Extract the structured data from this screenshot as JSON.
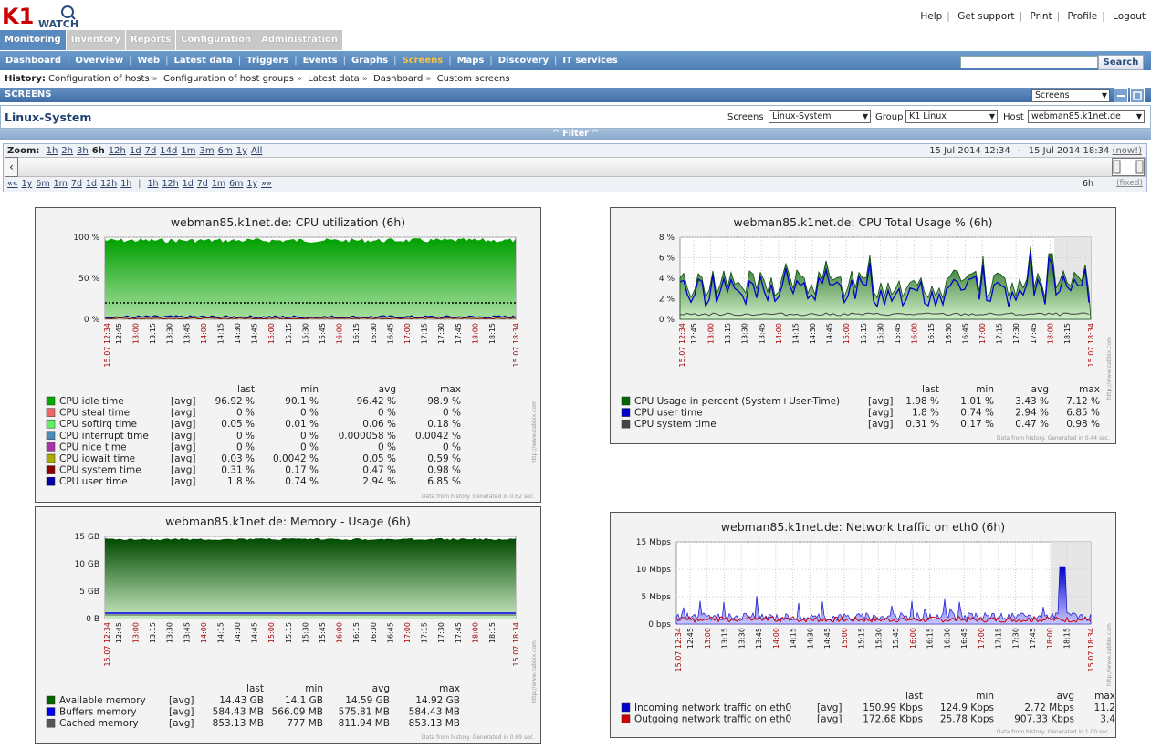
{
  "logo": {
    "k1": "K1",
    "watch": "WATCH"
  },
  "toplinks": [
    "Help",
    "Get support",
    "Print",
    "Profile",
    "Logout"
  ],
  "mainnav": [
    {
      "label": "Monitoring",
      "active": true
    },
    {
      "label": "Inventory",
      "active": false
    },
    {
      "label": "Reports",
      "active": false
    },
    {
      "label": "Configuration",
      "active": false
    },
    {
      "label": "Administration",
      "active": false
    }
  ],
  "subnav": [
    {
      "label": "Dashboard",
      "active": false
    },
    {
      "label": "Overview",
      "active": false
    },
    {
      "label": "Web",
      "active": false
    },
    {
      "label": "Latest data",
      "active": false
    },
    {
      "label": "Triggers",
      "active": false
    },
    {
      "label": "Events",
      "active": false
    },
    {
      "label": "Graphs",
      "active": false
    },
    {
      "label": "Screens",
      "active": true
    },
    {
      "label": "Maps",
      "active": false
    },
    {
      "label": "Discovery",
      "active": false
    },
    {
      "label": "IT services",
      "active": false
    }
  ],
  "search": {
    "value": "",
    "button": "Search"
  },
  "history": {
    "label": "History:",
    "items": [
      "Configuration of hosts",
      "Configuration of host groups",
      "Latest data",
      "Dashboard",
      "Custom screens"
    ]
  },
  "screensbar": {
    "title": "SCREENS",
    "select": "Screens"
  },
  "screen": {
    "title": "Linux-System",
    "screens_label": "Screens",
    "screens_value": "Linux-System",
    "group_label": "Group",
    "group_value": "K1 Linux",
    "host_label": "Host",
    "host_value": "webman85.k1net.de"
  },
  "filter": {
    "label": "Filter"
  },
  "zoom": {
    "label": "Zoom:",
    "options": [
      "1h",
      "2h",
      "3h",
      "6h",
      "12h",
      "1d",
      "7d",
      "14d",
      "1m",
      "3m",
      "6m",
      "1y",
      "All"
    ],
    "active": "6h",
    "from": "15 Jul 2014 12:34",
    "dash": "-",
    "to": "15 Jul 2014 18:34",
    "now": "(now!)",
    "nav_back": [
      "««",
      "1y",
      "6m",
      "1m",
      "7d",
      "1d",
      "12h",
      "1h"
    ],
    "nav_fwd": [
      "1h",
      "12h",
      "1d",
      "7d",
      "1m",
      "6m",
      "1y",
      "»»"
    ],
    "period": "6h",
    "fixed": "(fixed)"
  },
  "graphs": {
    "time_ticks": [
      "12:45",
      "13:00",
      "13:15",
      "13:30",
      "13:45",
      "14:00",
      "14:15",
      "14:30",
      "14:45",
      "15:00",
      "15:15",
      "15:30",
      "15:45",
      "16:00",
      "16:15",
      "16:30",
      "16:45",
      "17:00",
      "17:15",
      "17:30",
      "17:45",
      "18:00",
      "18:15"
    ],
    "time_start": "15.07 12:34",
    "time_end": "15.07 18:34",
    "col_headers": [
      "last",
      "min",
      "avg",
      "max"
    ],
    "watermark": "http://www.zabbix.com",
    "cpu": {
      "title": "webman85.k1net.de: CPU utilization (6h)",
      "yticks": [
        "100 %",
        "50 %",
        "0 %"
      ],
      "legend": [
        {
          "color": "#00aa00",
          "name": "CPU idle time",
          "fn": "[avg]",
          "last": "96.92 %",
          "min": "90.1 %",
          "avg": "96.42 %",
          "max": "98.9 %"
        },
        {
          "color": "#ee6666",
          "name": "CPU steal time",
          "fn": "[avg]",
          "last": "0 %",
          "min": "0 %",
          "avg": "0 %",
          "max": "0 %"
        },
        {
          "color": "#66ee66",
          "name": "CPU softirq time",
          "fn": "[avg]",
          "last": "0.05 %",
          "min": "0.01 %",
          "avg": "0.06 %",
          "max": "0.18 %"
        },
        {
          "color": "#4a8ab8",
          "name": "CPU interrupt time",
          "fn": "[avg]",
          "last": "0 %",
          "min": "0 %",
          "avg": "0.000058 %",
          "max": "0.0042 %"
        },
        {
          "color": "#aa33aa",
          "name": "CPU nice time",
          "fn": "[avg]",
          "last": "0 %",
          "min": "0 %",
          "avg": "0 %",
          "max": "0 %"
        },
        {
          "color": "#aaaa00",
          "name": "CPU iowait time",
          "fn": "[avg]",
          "last": "0.03 %",
          "min": "0.0042 %",
          "avg": "0.05 %",
          "max": "0.59 %"
        },
        {
          "color": "#880000",
          "name": "CPU system time",
          "fn": "[avg]",
          "last": "0.31 %",
          "min": "0.17 %",
          "avg": "0.47 %",
          "max": "0.98 %"
        },
        {
          "color": "#0000aa",
          "name": "CPU user time",
          "fn": "[avg]",
          "last": "1.8 %",
          "min": "0.74 %",
          "avg": "2.94 %",
          "max": "6.85 %"
        }
      ],
      "footer": "Data from history. Generated in 0.62 sec."
    },
    "cputotal": {
      "title": "webman85.k1net.de: CPU Total Usage % (6h)",
      "yticks": [
        "8 %",
        "6 %",
        "4 %",
        "2 %",
        "0 %"
      ],
      "legend": [
        {
          "color": "#006600",
          "name": "CPU Usage in percent (System+User-Time)",
          "fn": "[avg]",
          "last": "1.98 %",
          "min": "1.01 %",
          "avg": "3.43 %",
          "max": "7.12 %"
        },
        {
          "color": "#0000cc",
          "name": "CPU user time",
          "fn": "[avg]",
          "last": "1.8 %",
          "min": "0.74 %",
          "avg": "2.94 %",
          "max": "6.85 %"
        },
        {
          "color": "#444444",
          "name": "CPU system time",
          "fn": "[avg]",
          "last": "0.31 %",
          "min": "0.17 %",
          "avg": "0.47 %",
          "max": "0.98 %"
        }
      ],
      "footer": "Data from history. Generated in 0.44 sec."
    },
    "memory": {
      "title": "webman85.k1net.de: Memory - Usage (6h)",
      "yticks": [
        "15 GB",
        "10 GB",
        "5 GB",
        "0 B"
      ],
      "legend": [
        {
          "color": "#006600",
          "name": "Available memory",
          "fn": "[avg]",
          "last": "14.43 GB",
          "min": "14.1 GB",
          "avg": "14.59 GB",
          "max": "14.92 GB"
        },
        {
          "color": "#0000ee",
          "name": "Buffers memory",
          "fn": "[avg]",
          "last": "584.43 MB",
          "min": "566.09 MB",
          "avg": "575.81 MB",
          "max": "584.43 MB"
        },
        {
          "color": "#555555",
          "name": "Cached memory",
          "fn": "[avg]",
          "last": "853.13 MB",
          "min": "777 MB",
          "avg": "811.94 MB",
          "max": "853.13 MB"
        }
      ],
      "footer": "Data from history. Generated in 0.69 sec."
    },
    "network": {
      "title": "webman85.k1net.de: Network traffic on eth0 (6h)",
      "yticks": [
        "15 Mbps",
        "10 Mbps",
        "5 Mbps",
        "0 bps"
      ],
      "legend": [
        {
          "color": "#0000cc",
          "name": "Incoming network traffic on eth0",
          "fn": "[avg]",
          "last": "150.99 Kbps",
          "min": "124.9 Kbps",
          "avg": "2.72 Mbps",
          "max": "11.2"
        },
        {
          "color": "#cc0000",
          "name": "Outgoing network traffic on eth0",
          "fn": "[avg]",
          "last": "172.68 Kbps",
          "min": "25.78 Kbps",
          "avg": "907.33 Kbps",
          "max": "3.4"
        }
      ],
      "footer": "Data from history. Generated in 1.00 sec."
    }
  },
  "colors": {
    "accent": "#4d7db3",
    "active_tab": "#f6c343",
    "graph_green": "#009900",
    "graph_blue": "#0000cc",
    "graph_red": "#cc0000"
  }
}
